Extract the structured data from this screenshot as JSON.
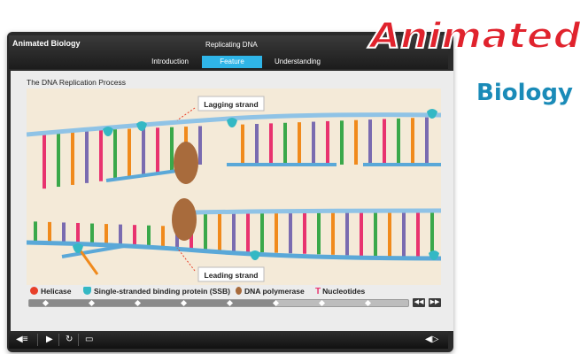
{
  "header": {
    "app_title": "Animated Biology",
    "lesson_title": "Replicating DNA",
    "tabs": [
      {
        "label": "Introduction",
        "active": false
      },
      {
        "label": "Feature",
        "active": true
      },
      {
        "label": "Understanding",
        "active": false
      }
    ]
  },
  "main": {
    "title": "The DNA Replication Process",
    "labels": {
      "lagging": "Lagging strand",
      "leading": "Leading strand"
    }
  },
  "legend": {
    "helicase": "Helicase",
    "ssb": "Single-stranded binding protein (SSB)",
    "polymerase": "DNA polymerase",
    "nucleotides": "Nucleotides"
  },
  "timeline": {
    "progress": 0.65,
    "marker_count": 8,
    "prev_icon": "rewind-icon",
    "next_icon": "fast-forward-icon"
  },
  "controls": [
    "audio-toggle-icon",
    "play-icon",
    "replay-icon",
    "captions-icon",
    "volume-icon"
  ],
  "brand": {
    "word1": "Animated",
    "word2": "Biology"
  },
  "colors": {
    "accent": "#2fb5e8",
    "strand_backbone": "#8fc3e6",
    "helicase": "#e8402a",
    "ssb": "#34b8c4",
    "polymerase": "#a86b3c",
    "nucleotide_pink": "#e8336f",
    "nucleotide_green": "#3aa84a",
    "nucleotide_orange": "#f08a1c",
    "nucleotide_purple": "#7a6bb0",
    "brand_red": "#e0232d",
    "brand_blue": "#1a8bb8"
  }
}
